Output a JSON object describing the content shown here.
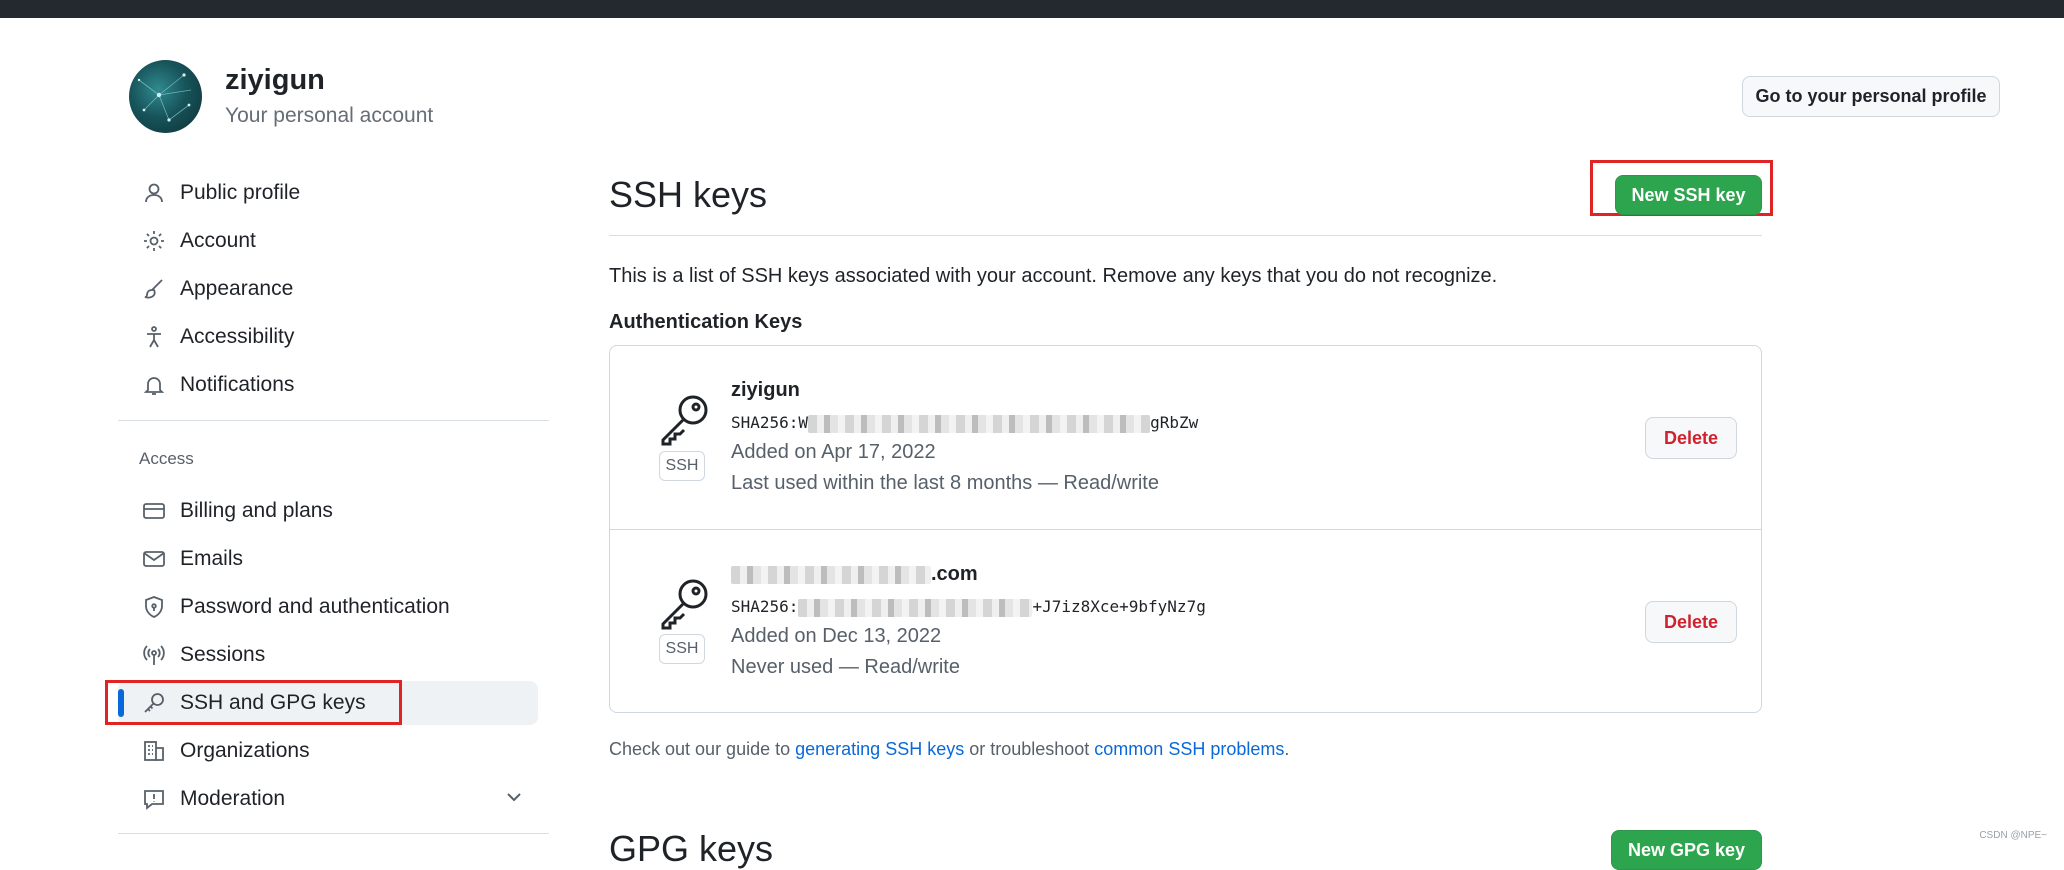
{
  "account": {
    "name": "ziyigun",
    "subtitle": "Your personal account",
    "profile_button": "Go to your personal profile"
  },
  "sidebar": {
    "items": [
      {
        "label": "Public profile",
        "icon": "person-icon"
      },
      {
        "label": "Account",
        "icon": "gear-icon"
      },
      {
        "label": "Appearance",
        "icon": "paintbrush-icon"
      },
      {
        "label": "Accessibility",
        "icon": "accessibility-icon"
      },
      {
        "label": "Notifications",
        "icon": "bell-icon"
      }
    ],
    "access_heading": "Access",
    "access_items": [
      {
        "label": "Billing and plans",
        "icon": "credit-card-icon"
      },
      {
        "label": "Emails",
        "icon": "mail-icon"
      },
      {
        "label": "Password and authentication",
        "icon": "shield-lock-icon"
      },
      {
        "label": "Sessions",
        "icon": "broadcast-icon"
      },
      {
        "label": "SSH and GPG keys",
        "icon": "key-icon",
        "active": true
      },
      {
        "label": "Organizations",
        "icon": "organization-icon"
      },
      {
        "label": "Moderation",
        "icon": "report-icon",
        "expandable": true
      }
    ]
  },
  "main": {
    "title": "SSH keys",
    "new_button": "New SSH key",
    "description": "This is a list of SSH keys associated with your account. Remove any keys that you do not recognize.",
    "auth_heading": "Authentication Keys",
    "keys": [
      {
        "title": "ziyigun",
        "fingerprint_prefix": "SHA256:W",
        "fingerprint_suffix": "gRbZw",
        "added": "Added on Apr 17, 2022",
        "usage": "Last used within the last 8 months — Read/write",
        "badge": "SSH",
        "delete_label": "Delete"
      },
      {
        "title_suffix": ".com",
        "fingerprint_prefix": "SHA256:",
        "fingerprint_suffix": "+J7iz8Xce+9bfyNz7g",
        "added": "Added on Dec 13, 2022",
        "usage": "Never used — Read/write",
        "badge": "SSH",
        "delete_label": "Delete"
      }
    ],
    "footnote": {
      "prefix": "Check out our guide to ",
      "link1": "generating SSH keys",
      "middle": " or troubleshoot ",
      "link2": "common SSH problems",
      "suffix": "."
    },
    "gpg_title": "GPG keys",
    "new_gpg_button": "New GPG key"
  },
  "watermark": "CSDN @NPE~",
  "colors": {
    "accent_green": "#2da44e",
    "active_indicator": "#0969da",
    "danger": "#cf222e",
    "highlight_box": "#e02424"
  }
}
